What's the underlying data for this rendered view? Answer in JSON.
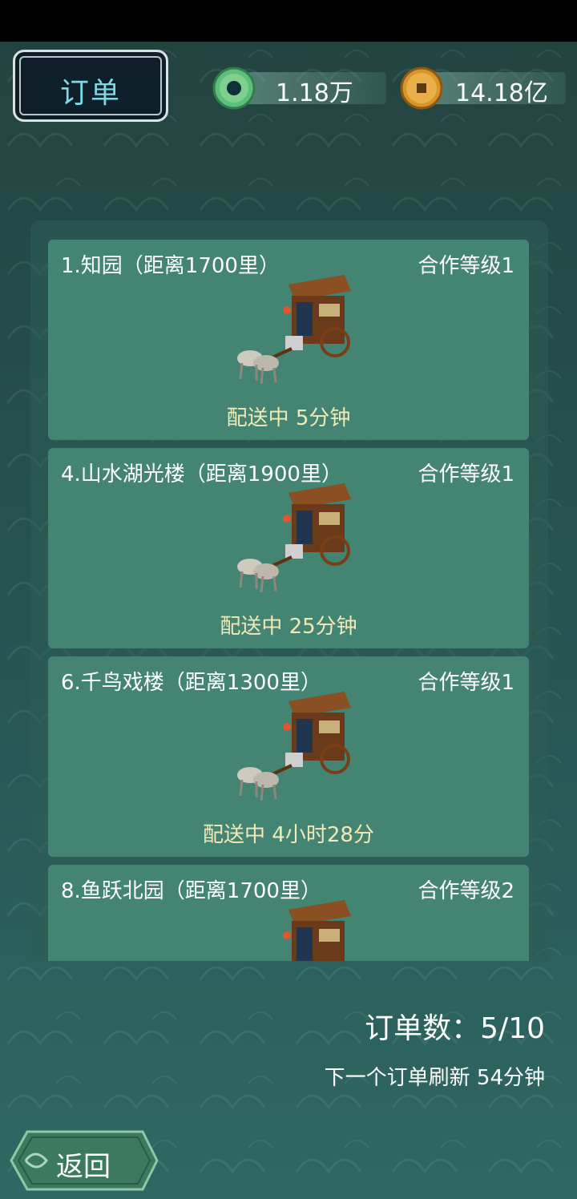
{
  "header": {
    "title": "订单",
    "jade_amount": "1.18万",
    "coin_amount": "14.18亿"
  },
  "orders": [
    {
      "name": "1.知园（距离1700里）",
      "level": "合作等级1",
      "status": "配送中 5分钟"
    },
    {
      "name": "4.山水湖光楼（距离1900里）",
      "level": "合作等级1",
      "status": "配送中 25分钟"
    },
    {
      "name": "6.千鸟戏楼（距离1300里）",
      "level": "合作等级1",
      "status": "配送中 4小时28分"
    },
    {
      "name": "8.鱼跃北园（距离1700里）",
      "level": "合作等级2",
      "status": ""
    }
  ],
  "footer": {
    "order_count": "订单数：5/10",
    "refresh_text": "下一个订单刷新 54分钟",
    "back_label": "返回"
  },
  "icons": {
    "jade": "jade-disc-icon",
    "coin": "copper-coin-icon",
    "carriage": "horse-carriage-icon"
  }
}
